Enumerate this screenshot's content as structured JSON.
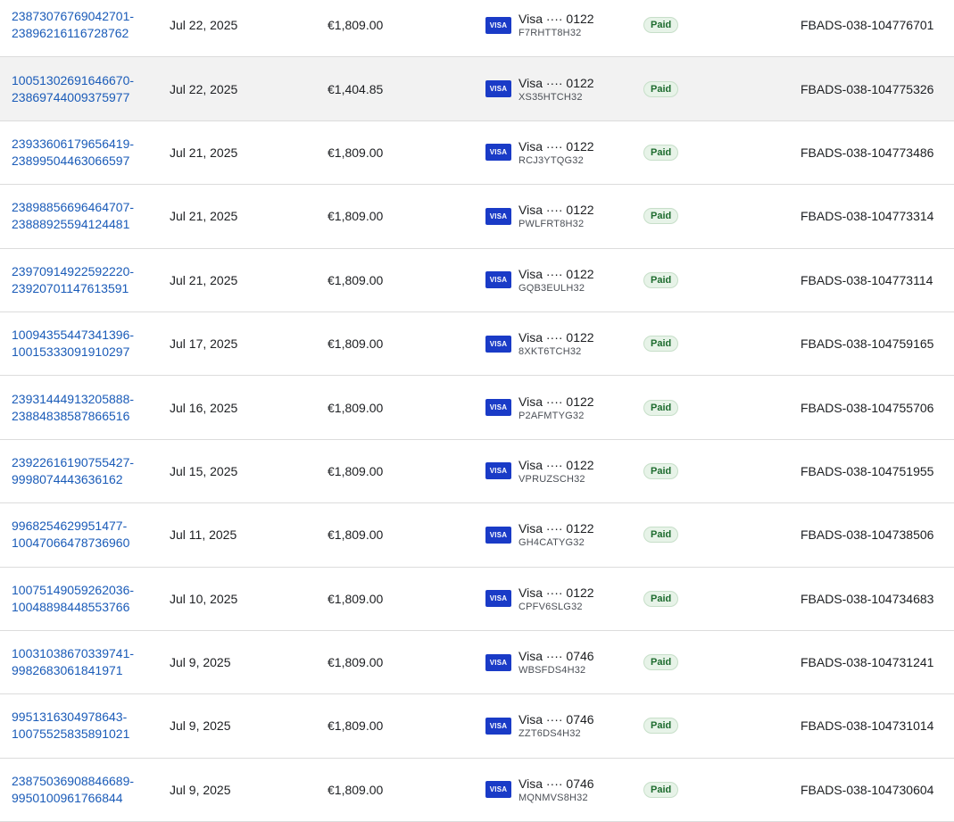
{
  "brand": {
    "visa_label": "VISA",
    "link_color": "#1a5bb8",
    "paid_bg": "#e7f3e8"
  },
  "rows": [
    {
      "id_line1": "23873076769042701-",
      "id_line2": "23896216116728762",
      "date": "Jul 22, 2025",
      "amount": "€1,809.00",
      "payment": "Visa ···· 0122",
      "payment_code": "F7RHTT8H32",
      "status": "Paid",
      "reference": "FBADS-038-104776701"
    },
    {
      "id_line1": "10051302691646670-",
      "id_line2": "23869744009375977",
      "date": "Jul 22, 2025",
      "amount": "€1,404.85",
      "payment": "Visa ···· 0122",
      "payment_code": "XS35HTCH32",
      "status": "Paid",
      "reference": "FBADS-038-104775326"
    },
    {
      "id_line1": "23933606179656419-",
      "id_line2": "23899504463066597",
      "date": "Jul 21, 2025",
      "amount": "€1,809.00",
      "payment": "Visa ···· 0122",
      "payment_code": "RCJ3YTQG32",
      "status": "Paid",
      "reference": "FBADS-038-104773486"
    },
    {
      "id_line1": "23898856696464707-",
      "id_line2": "23888925594124481",
      "date": "Jul 21, 2025",
      "amount": "€1,809.00",
      "payment": "Visa ···· 0122",
      "payment_code": "PWLFRT8H32",
      "status": "Paid",
      "reference": "FBADS-038-104773314"
    },
    {
      "id_line1": "23970914922592220-",
      "id_line2": "23920701147613591",
      "date": "Jul 21, 2025",
      "amount": "€1,809.00",
      "payment": "Visa ···· 0122",
      "payment_code": "GQB3EULH32",
      "status": "Paid",
      "reference": "FBADS-038-104773114"
    },
    {
      "id_line1": "10094355447341396-",
      "id_line2": "10015333091910297",
      "date": "Jul 17, 2025",
      "amount": "€1,809.00",
      "payment": "Visa ···· 0122",
      "payment_code": "8XKT6TCH32",
      "status": "Paid",
      "reference": "FBADS-038-104759165"
    },
    {
      "id_line1": "23931444913205888-",
      "id_line2": "23884838587866516",
      "date": "Jul 16, 2025",
      "amount": "€1,809.00",
      "payment": "Visa ···· 0122",
      "payment_code": "P2AFMTYG32",
      "status": "Paid",
      "reference": "FBADS-038-104755706"
    },
    {
      "id_line1": "23922616190755427-",
      "id_line2": "9998074443636162",
      "date": "Jul 15, 2025",
      "amount": "€1,809.00",
      "payment": "Visa ···· 0122",
      "payment_code": "VPRUZSCH32",
      "status": "Paid",
      "reference": "FBADS-038-104751955"
    },
    {
      "id_line1": "9968254629951477-",
      "id_line2": "10047066478736960",
      "date": "Jul 11, 2025",
      "amount": "€1,809.00",
      "payment": "Visa ···· 0122",
      "payment_code": "GH4CATYG32",
      "status": "Paid",
      "reference": "FBADS-038-104738506"
    },
    {
      "id_line1": "10075149059262036-",
      "id_line2": "10048898448553766",
      "date": "Jul 10, 2025",
      "amount": "€1,809.00",
      "payment": "Visa ···· 0122",
      "payment_code": "CPFV6SLG32",
      "status": "Paid",
      "reference": "FBADS-038-104734683"
    },
    {
      "id_line1": "10031038670339741-",
      "id_line2": "9982683061841971",
      "date": "Jul 9, 2025",
      "amount": "€1,809.00",
      "payment": "Visa ···· 0746",
      "payment_code": "WBSFDS4H32",
      "status": "Paid",
      "reference": "FBADS-038-104731241"
    },
    {
      "id_line1": "9951316304978643-",
      "id_line2": "10075525835891021",
      "date": "Jul 9, 2025",
      "amount": "€1,809.00",
      "payment": "Visa ···· 0746",
      "payment_code": "ZZT6DS4H32",
      "status": "Paid",
      "reference": "FBADS-038-104731014"
    },
    {
      "id_line1": "23875036908846689-",
      "id_line2": "9950100961766844",
      "date": "Jul 9, 2025",
      "amount": "€1,809.00",
      "payment": "Visa ···· 0746",
      "payment_code": "MQNMVS8H32",
      "status": "Paid",
      "reference": "FBADS-038-104730604"
    }
  ]
}
